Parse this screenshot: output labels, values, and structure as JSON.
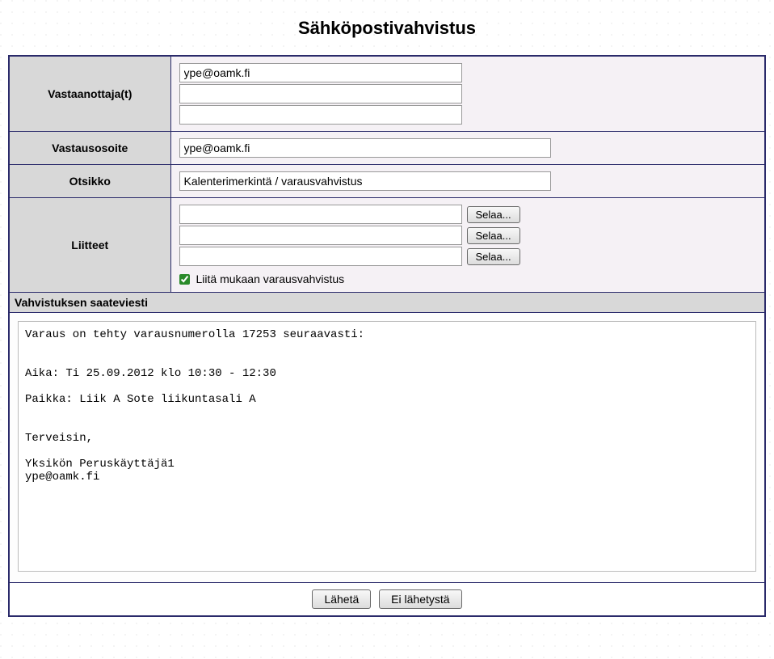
{
  "title": "Sähköpostivahvistus",
  "labels": {
    "recipients": "Vastaanottaja(t)",
    "replyto": "Vastausosoite",
    "subject": "Otsikko",
    "attachments": "Liitteet",
    "message_header": "Vahvistuksen saateviesti"
  },
  "recipients": {
    "field1": "ype@oamk.fi",
    "field2": "",
    "field3": ""
  },
  "replyto": "ype@oamk.fi",
  "subject": "Kalenterimerkintä / varausvahvistus",
  "attachments": {
    "file1": "",
    "file2": "",
    "file3": "",
    "browse_label": "Selaa...",
    "include_checkbox_label": "Liitä mukaan varausvahvistus",
    "include_checked": true
  },
  "message": "Varaus on tehty varausnumerolla 17253 seuraavasti:\n\n\nAika: Ti 25.09.2012 klo 10:30 - 12:30\n\nPaikka: Liik A Sote liikuntasali A\n\n\nTerveisin,\n\nYksikön Peruskäyttäjä1\nype@oamk.fi",
  "buttons": {
    "send": "Lähetä",
    "nosend": "Ei lähetystä"
  }
}
